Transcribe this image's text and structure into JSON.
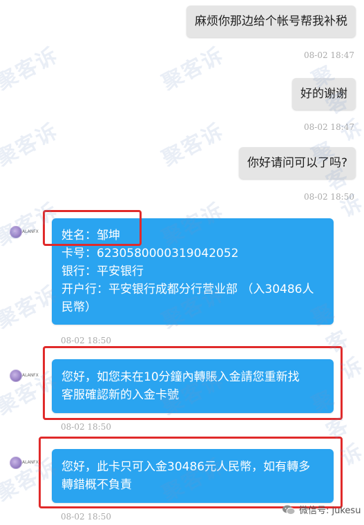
{
  "watermark": "聚客诉",
  "messages": [
    {
      "side": "out",
      "text": "麻烦你那边给个帐号帮我补税",
      "time": "08-02 18:47"
    },
    {
      "side": "out",
      "text": "好的谢谢",
      "time": "08-02 18:47"
    },
    {
      "side": "out",
      "text": "你好请问可以了吗?",
      "time": "08-02 18:50"
    },
    {
      "side": "in",
      "sender": "ALANFX",
      "lines": [
        "姓名：邹坤",
        "卡号：6230580000319042052",
        "银行：平安银行",
        "开户行：平安银行成都分行营业部 （入30486人",
        "民幣）"
      ],
      "time": "08-02 18:50"
    },
    {
      "side": "in",
      "sender": "ALANFX",
      "lines": [
        "您好，如您未在10分鐘內轉賬入金請您重新找",
        "客服確認新的入金卡號"
      ],
      "time": "08-02 18:50"
    },
    {
      "side": "in",
      "sender": "ALANFX",
      "lines": [
        "您好，此卡只可入金30486元人民幣，如有轉多",
        "轉錯概不負責"
      ],
      "time": "08-02 18:50"
    }
  ],
  "footer": {
    "label": "微信号: jukesu"
  },
  "colors": {
    "incoming_bubble": "#2aa4f0",
    "outgoing_bubble": "#e5e5e5",
    "highlight_box": "#e02a2a"
  }
}
